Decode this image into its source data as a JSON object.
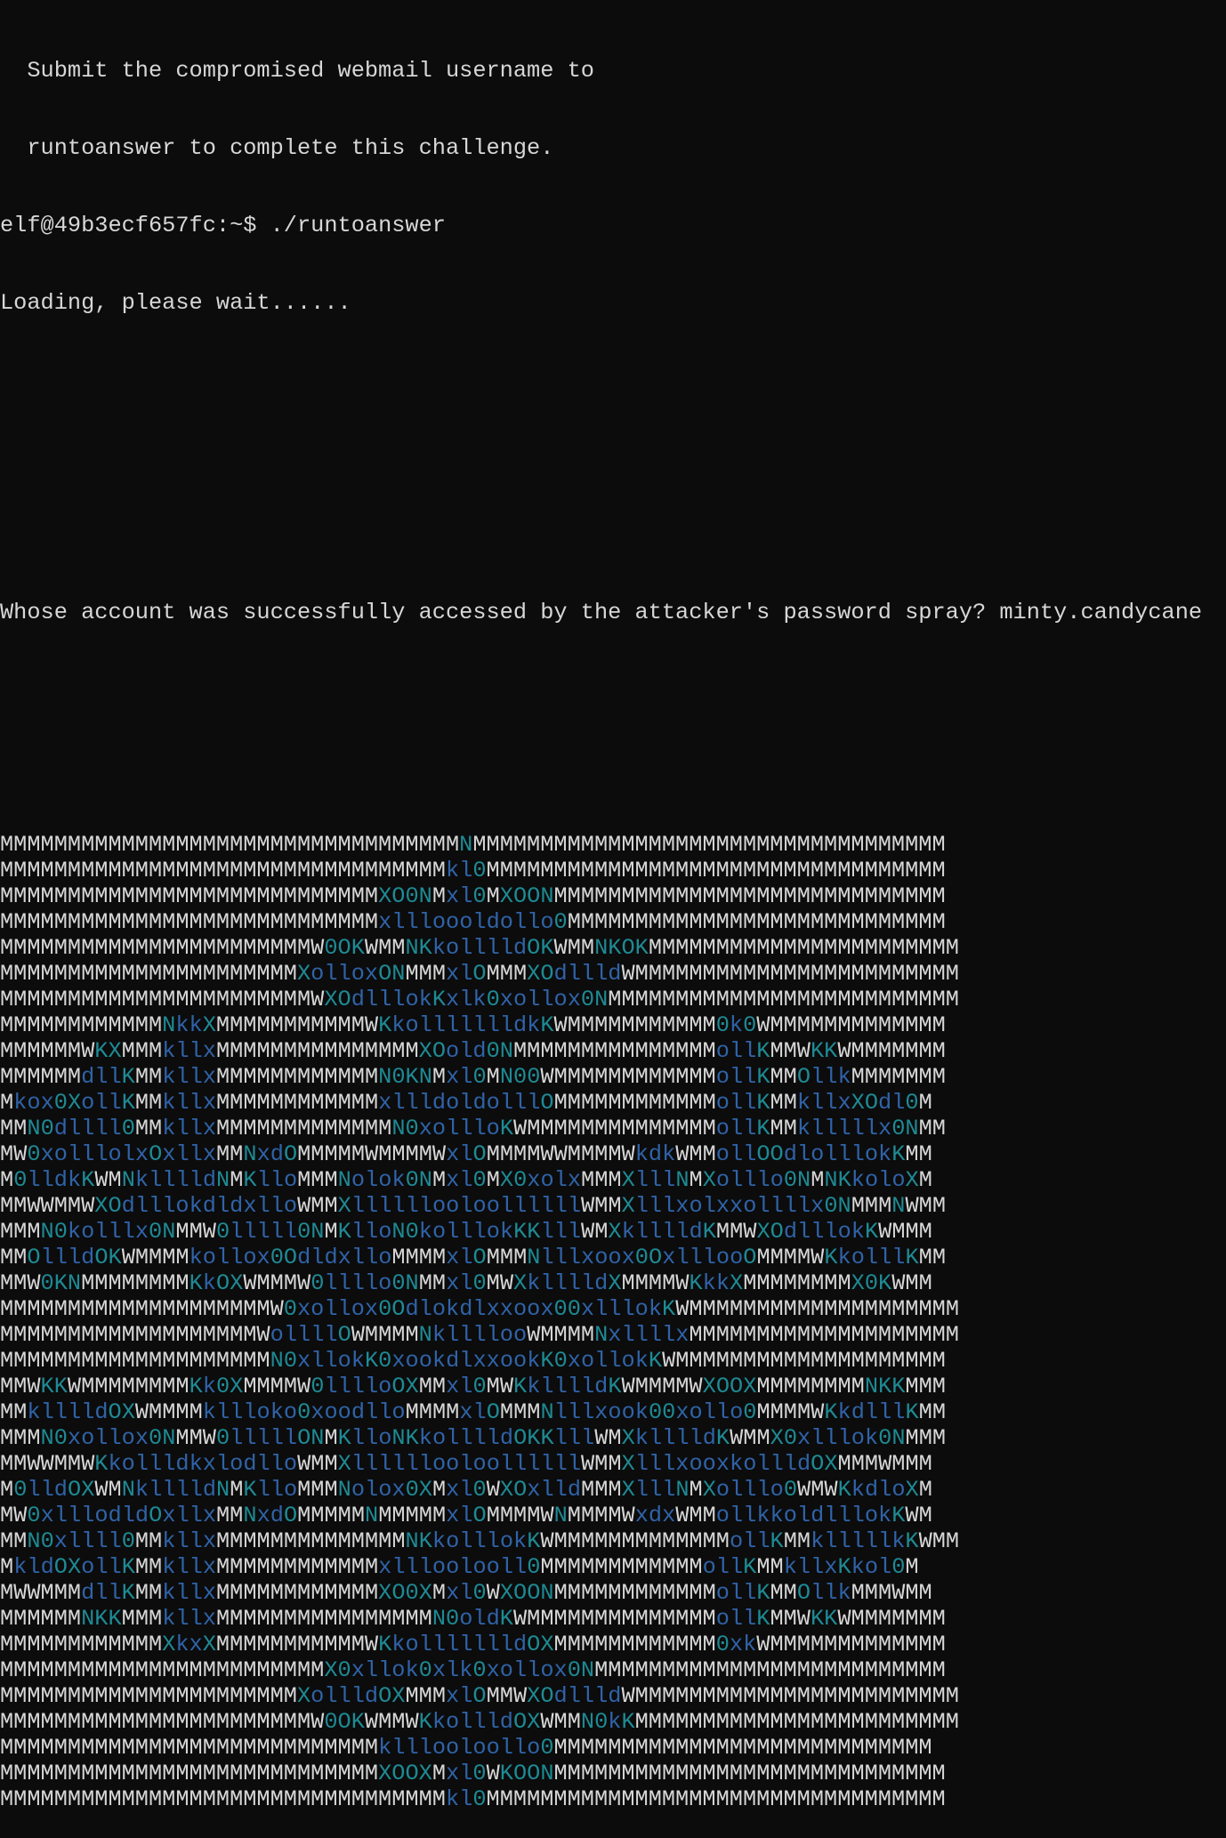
{
  "terminal": {
    "intro_line_1": "  Submit the compromised webmail username to",
    "intro_line_2": "  runtoanswer to complete this challenge.",
    "prompt": "elf@49b3ecf657fc:~$ ",
    "command": "./runtoanswer",
    "loading": "Loading, please wait......",
    "question": "Whose account was successfully accessed by the attacker's password spray? ",
    "answer": "minty.candycane"
  },
  "colors": {
    "background": "#0c0c0c",
    "text": "#d7d7d7",
    "teal": "#1e8a94",
    "blue": "#2f63a8"
  },
  "ascii_art": [
    "MMMMMMMMMMMMMMMMMMMMMMMMMMMMMMMMMMNMMMMMMMMMMMMMMMMMMMMMMMMMMMMMMMMMMM",
    "MMMMMMMMMMMMMMMMMMMMMMMMMMMMMMMMMkl0MMMMMMMMMMMMMMMMMMMMMMMMMMMMMMMMMM",
    "MMMMMMMMMMMMMMMMMMMMMMMMMMMMXO0NMxl0MXOONMMMMMMMMMMMMMMMMMMMMMMMMMMMMM",
    "MMMMMMMMMMMMMMMMMMMMMMMMMMMMxllloooldollo0MMMMMMMMMMMMMMMMMMMMMMMMMMMM",
    "MMMMMMMMMMMMMMMMMMMMMMMW0OKWMMNKkolllldOKWMMNKOKMMMMMMMMMMMMMMMMMMMMMMM",
    "MMMMMMMMMMMMMMMMMMMMMMXolloxONMMMxlOMMMXOdllldWMMMMMMMMMMMMMMMMMMMMMMMM",
    "MMMMMMMMMMMMMMMMMMMMMMMWXOdlllokKxlk0xollox0NMMMMMMMMMMMMMMMMMMMMMMMMMM",
    "MMMMMMMMMMMMNkkXMMMMMMMMMMMWKkollllllldkKWMMMMMMMMMMM0k0WMMMMMMMMMMMMM",
    "MMMMMMWKXMMMkllxMMMMMMMMMMMMMMMXOold0NMMMMMMMMMMMMMMMollKMMWKKWMMMMMMM",
    "MMMMMMdllKMMkllxMMMMMMMMMMMMN0KNMxl0MN00WMMMMMMMMMMMMollKMMOllkMMMMMMM",
    "Mkox0XollKMMkllxMMMMMMMMMMMMxllldoldolllOMMMMMMMMMMMMollKMMkllxXOdl0M",
    "MMN0dllll0MMkllxMMMMMMMMMMMMMN0xollloKWMMMMMMMMMMMMMMollKMMklllllx0NMM",
    "MW0xolllolxOxllxMMNxdOMMMMMWMMMMWxlOMMMMWWMMMMWkdkWMMollOOdlolllokKMM",
    "M0lldkKWMNklllldNMKlloMMMNolok0NMxl0MX0xolxMMMXlllNMXolllo0NMNKkoloXM",
    "MMWWMMWXOdlllokdldxlloWMMXllllllooloollllllWMMXlllxolxxollllx0NMMMNWMM",
    "MMMN0kolllx0NMMW0lllll0NMKlloN0kolllokKKlllWMXklllldKMMWXOdlllokKWMMM",
    "MMOllldOKWMMMMkollox0OdldxlloMMMMxlOMMMNlllxoox0OxlllooOMMMMWKkolllKMM",
    "MMW0KNMMMMMMMMKkOXWMMMW0llllo0NMMxl0MWXklllldXMMMMWKkkXMMMMMMMMX0KWMM",
    "MMMMMMMMMMMMMMMMMMMMW0xollox0Odlokdlxxoox00xlllokKWMMMMMMMMMMMMMMMMMMMM",
    "MMMMMMMMMMMMMMMMMMMWollllOWMMMMNkllllooWMMMMNxllllxMMMMMMMMMMMMMMMMMMMM",
    "MMMMMMMMMMMMMMMMMMMMN0xllokK0xookdlxxookK0xollokKWMMMMMMMMMMMMMMMMMMMM",
    "MMWKKWMMMMMMMMKk0XMMMMW0lllloOXMMxl0MWKklllldKWMMMMWXOOXMMMMMMMMNKKMMM",
    "MMklllldOXWMMMMkllloko0xoodlloMMMMxlOMMMNlllxook00xollo0MMMMWKkdlllKMM",
    "MMMN0xollox0NMMW0lllllONMKlloNKkolllldOKKlllWMXklllldKWMMX0xlllok0NMMM",
    "MMWWMMWKkollldkxlodlloWMMXllllllooloollllllWMMXlllxooxkollldOXMMMWMMM",
    "M0lldOXWMNklllldNMKlloMMMNolox0XMxl0WXOxlldMMMXlllNMXolllo0WMWKkdloXM",
    "MW0xlllodldOxllxMMNxdOMMMMMNMMMMMxlOMMMMWNMMMMWxdxWMMollkkoldlllokKWM",
    "MMN0xllll0MMkllxMMMMMMMMMMMMMMNKkolllokKWMMMMMMMMMMMMMollKMMklllllkKWMM",
    "MkldOXollKMMkllxMMMMMMMMMMMMxllloolooll0MMMMMMMMMMMMollKMMkllxKkol0M",
    "MWWMMMdllKMMkllxMMMMMMMMMMMMXO0XMxl0WXOONMMMMMMMMMMMMollKMMOllkMMMWMM",
    "MMMMMMNKKMMMkllxMMMMMMMMMMMMMMMMN0oldKWMMMMMMMMMMMMMMollKMMWKKWMMMMMMM",
    "MMMMMMMMMMMMXkxXMMMMMMMMMMMWKkollllllldOXMMMMMMMMMMMM0xkWMMMMMMMMMMMMM",
    "MMMMMMMMMMMMMMMMMMMMMMMMX0xllok0xlk0xollox0NMMMMMMMMMMMMMMMMMMMMMMMMMM",
    "MMMMMMMMMMMMMMMMMMMMMMXollldOXMMMxlOMMWXOdllldWMMMMMMMMMMMMMMMMMMMMMMMM",
    "MMMMMMMMMMMMMMMMMMMMMMMW0OKWMMWKkollldOXWMMN0kKMMMMMMMMMMMMMMMMMMMMMMMM",
    "MMMMMMMMMMMMMMMMMMMMMMMMMMMMklllooloollo0MMMMMMMMMMMMMMMMMMMMMMMMMMMM",
    "MMMMMMMMMMMMMMMMMMMMMMMMMMMMXOOXMxl0WKOONMMMMMMMMMMMMMMMMMMMMMMMMMMMMM",
    "MMMMMMMMMMMMMMMMMMMMMMMMMMMMMMMMMkl0MMMMMMMMMMMMMMMMMMMMMMMMMMMMMMMMMM"
  ]
}
